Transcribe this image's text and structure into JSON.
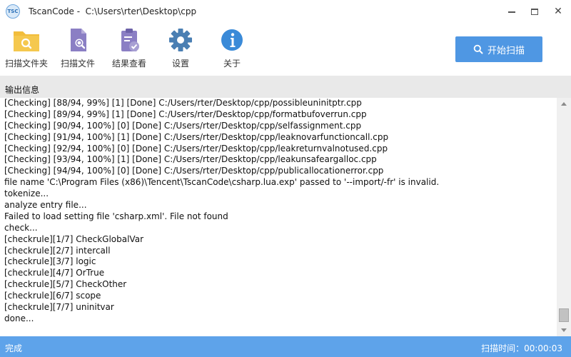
{
  "window": {
    "logo_text": "TSC",
    "app_name": "TscanCode",
    "path": "C:\\Users\\rter\\Desktop\\cpp"
  },
  "toolbar": {
    "items": [
      {
        "label": "扫描文件夹",
        "icon": "folder-search-icon"
      },
      {
        "label": "扫描文件",
        "icon": "file-search-icon"
      },
      {
        "label": "结果查看",
        "icon": "clipboard-check-icon"
      },
      {
        "label": "设置",
        "icon": "gear-icon"
      },
      {
        "label": "关于",
        "icon": "info-icon"
      }
    ],
    "scan_button": "开始扫描"
  },
  "output": {
    "title": "输出信息",
    "lines": [
      "[Checking] [88/94, 99%] [1] [Done] C:/Users/rter/Desktop/cpp/possibleuninitptr.cpp",
      "[Checking] [89/94, 99%] [1] [Done] C:/Users/rter/Desktop/cpp/formatbufoverrun.cpp",
      "[Checking] [90/94, 100%] [0] [Done] C:/Users/rter/Desktop/cpp/selfassignment.cpp",
      "[Checking] [91/94, 100%] [1] [Done] C:/Users/rter/Desktop/cpp/leaknovarfunctioncall.cpp",
      "[Checking] [92/94, 100%] [0] [Done] C:/Users/rter/Desktop/cpp/leakreturnvalnotused.cpp",
      "[Checking] [93/94, 100%] [1] [Done] C:/Users/rter/Desktop/cpp/leakunsafeargalloc.cpp",
      "[Checking] [94/94, 100%] [0] [Done] C:/Users/rter/Desktop/cpp/publicallocationerror.cpp",
      "file name 'C:\\Program Files (x86)\\Tencent\\TscanCode\\csharp.lua.exp' passed to '--import/-fr' is invalid.",
      "tokenize...",
      "analyze entry file...",
      "Failed to load setting file 'csharp.xml'. File not found",
      "check...",
      "[checkrule][1/7] CheckGlobalVar",
      "[checkrule][2/7] intercall",
      "[checkrule][3/7] logic",
      "[checkrule][4/7] OrTrue",
      "[checkrule][5/7] CheckOther",
      "[checkrule][6/7] scope",
      "[checkrule][7/7] uninitvar",
      "done..."
    ]
  },
  "status": {
    "left": "完成",
    "right": "扫描时间：00:00:03"
  },
  "colors": {
    "accent": "#4f97e3",
    "statusbar": "#5ea3ea",
    "icon_yellow": "#f2bd3c",
    "icon_purple": "#8b7fc4",
    "icon_blue": "#3a8ad8"
  }
}
